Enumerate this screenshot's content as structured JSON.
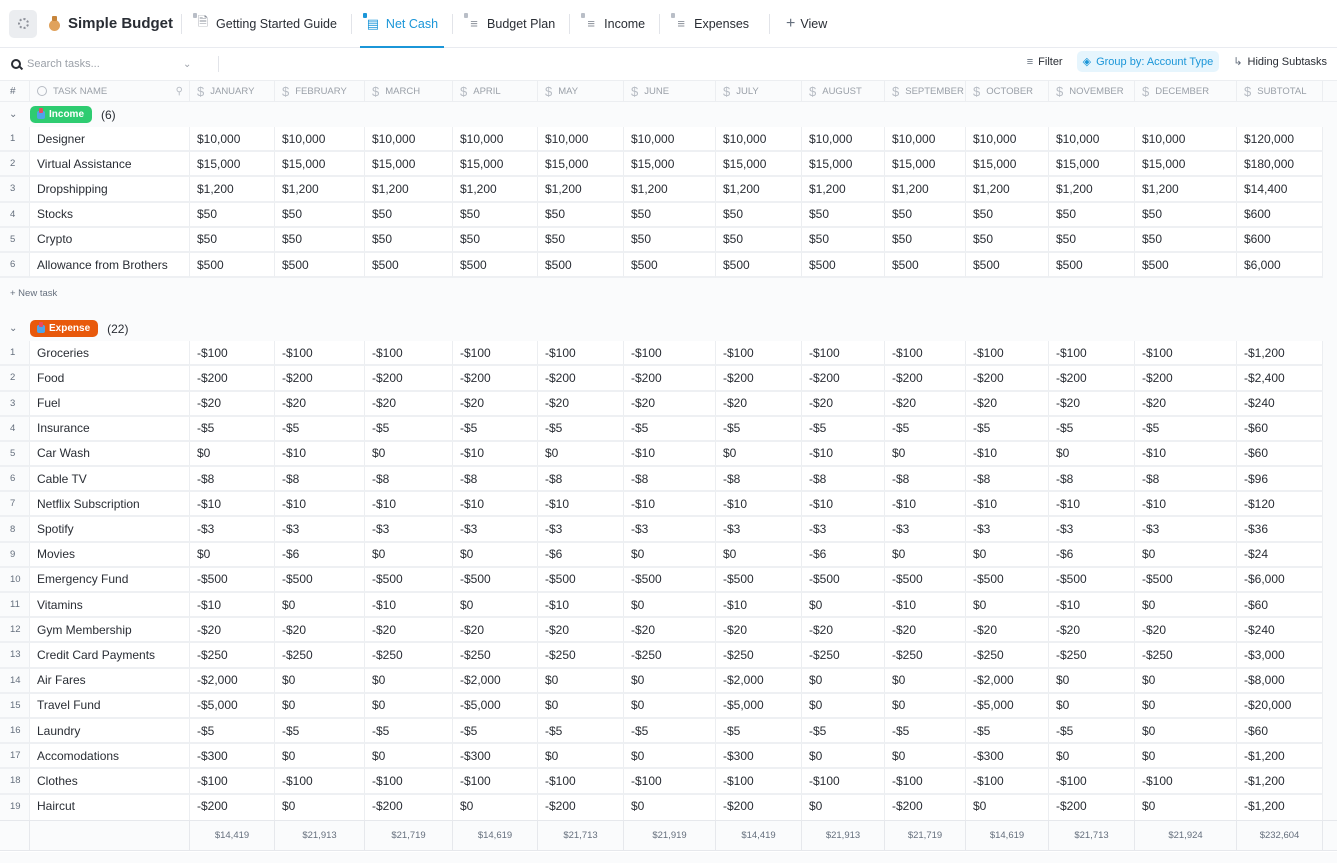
{
  "app": {
    "title": "Simple Budget",
    "workspace_icon": "loading-dots-icon",
    "title_icon": "money-bag-icon"
  },
  "tabs": [
    {
      "label": "Getting Started Guide",
      "icon": "doc-icon",
      "active": false
    },
    {
      "label": "Net Cash",
      "icon": "table-icon",
      "active": true
    },
    {
      "label": "Budget Plan",
      "icon": "list-icon",
      "active": false
    },
    {
      "label": "Income",
      "icon": "list-icon",
      "active": false
    },
    {
      "label": "Expenses",
      "icon": "list-icon",
      "active": false
    }
  ],
  "add_view_label": "View",
  "toolbar": {
    "search_placeholder": "Search tasks...",
    "filter_label": "Filter",
    "group_by_label": "Group by: Account Type",
    "subtasks_label": "Hiding Subtasks"
  },
  "colors": {
    "accent": "#1b96d8",
    "income": "#2ecc71",
    "expense": "#e8590c"
  },
  "columns": {
    "num": "#",
    "name": "TASK NAME",
    "months": [
      "JANUARY",
      "FEBRUARY",
      "MARCH",
      "APRIL",
      "MAY",
      "JUNE",
      "JULY",
      "AUGUST",
      "SEPTEMBER",
      "OCTOBER",
      "NOVEMBER",
      "DECEMBER",
      "SUBTOTAL"
    ]
  },
  "groups": [
    {
      "label": "Income",
      "count": "(6)",
      "color": "#2ecc71",
      "rows": [
        {
          "n": "1",
          "name": "Designer",
          "values": [
            "$10,000",
            "$10,000",
            "$10,000",
            "$10,000",
            "$10,000",
            "$10,000",
            "$10,000",
            "$10,000",
            "$10,000",
            "$10,000",
            "$10,000",
            "$10,000",
            "$120,000"
          ]
        },
        {
          "n": "2",
          "name": "Virtual Assistance",
          "values": [
            "$15,000",
            "$15,000",
            "$15,000",
            "$15,000",
            "$15,000",
            "$15,000",
            "$15,000",
            "$15,000",
            "$15,000",
            "$15,000",
            "$15,000",
            "$15,000",
            "$180,000"
          ]
        },
        {
          "n": "3",
          "name": "Dropshipping",
          "values": [
            "$1,200",
            "$1,200",
            "$1,200",
            "$1,200",
            "$1,200",
            "$1,200",
            "$1,200",
            "$1,200",
            "$1,200",
            "$1,200",
            "$1,200",
            "$1,200",
            "$14,400"
          ]
        },
        {
          "n": "4",
          "name": "Stocks",
          "values": [
            "$50",
            "$50",
            "$50",
            "$50",
            "$50",
            "$50",
            "$50",
            "$50",
            "$50",
            "$50",
            "$50",
            "$50",
            "$600"
          ]
        },
        {
          "n": "5",
          "name": "Crypto",
          "values": [
            "$50",
            "$50",
            "$50",
            "$50",
            "$50",
            "$50",
            "$50",
            "$50",
            "$50",
            "$50",
            "$50",
            "$50",
            "$600"
          ]
        },
        {
          "n": "6",
          "name": "Allowance from Brothers",
          "values": [
            "$500",
            "$500",
            "$500",
            "$500",
            "$500",
            "$500",
            "$500",
            "$500",
            "$500",
            "$500",
            "$500",
            "$500",
            "$6,000"
          ]
        }
      ],
      "new_task_label": "+ New task"
    },
    {
      "label": "Expense",
      "count": "(22)",
      "color": "#e8590c",
      "rows": [
        {
          "n": "1",
          "name": "Groceries",
          "values": [
            "-$100",
            "-$100",
            "-$100",
            "-$100",
            "-$100",
            "-$100",
            "-$100",
            "-$100",
            "-$100",
            "-$100",
            "-$100",
            "-$100",
            "-$1,200"
          ]
        },
        {
          "n": "2",
          "name": "Food",
          "values": [
            "-$200",
            "-$200",
            "-$200",
            "-$200",
            "-$200",
            "-$200",
            "-$200",
            "-$200",
            "-$200",
            "-$200",
            "-$200",
            "-$200",
            "-$2,400"
          ]
        },
        {
          "n": "3",
          "name": "Fuel",
          "values": [
            "-$20",
            "-$20",
            "-$20",
            "-$20",
            "-$20",
            "-$20",
            "-$20",
            "-$20",
            "-$20",
            "-$20",
            "-$20",
            "-$20",
            "-$240"
          ]
        },
        {
          "n": "4",
          "name": "Insurance",
          "values": [
            "-$5",
            "-$5",
            "-$5",
            "-$5",
            "-$5",
            "-$5",
            "-$5",
            "-$5",
            "-$5",
            "-$5",
            "-$5",
            "-$5",
            "-$60"
          ]
        },
        {
          "n": "5",
          "name": "Car Wash",
          "values": [
            "$0",
            "-$10",
            "$0",
            "-$10",
            "$0",
            "-$10",
            "$0",
            "-$10",
            "$0",
            "-$10",
            "$0",
            "-$10",
            "-$60"
          ]
        },
        {
          "n": "6",
          "name": "Cable TV",
          "values": [
            "-$8",
            "-$8",
            "-$8",
            "-$8",
            "-$8",
            "-$8",
            "-$8",
            "-$8",
            "-$8",
            "-$8",
            "-$8",
            "-$8",
            "-$96"
          ]
        },
        {
          "n": "7",
          "name": "Netflix Subscription",
          "values": [
            "-$10",
            "-$10",
            "-$10",
            "-$10",
            "-$10",
            "-$10",
            "-$10",
            "-$10",
            "-$10",
            "-$10",
            "-$10",
            "-$10",
            "-$120"
          ]
        },
        {
          "n": "8",
          "name": "Spotify",
          "values": [
            "-$3",
            "-$3",
            "-$3",
            "-$3",
            "-$3",
            "-$3",
            "-$3",
            "-$3",
            "-$3",
            "-$3",
            "-$3",
            "-$3",
            "-$36"
          ]
        },
        {
          "n": "9",
          "name": "Movies",
          "values": [
            "$0",
            "-$6",
            "$0",
            "$0",
            "-$6",
            "$0",
            "$0",
            "-$6",
            "$0",
            "$0",
            "-$6",
            "$0",
            "-$24"
          ]
        },
        {
          "n": "10",
          "name": "Emergency Fund",
          "values": [
            "-$500",
            "-$500",
            "-$500",
            "-$500",
            "-$500",
            "-$500",
            "-$500",
            "-$500",
            "-$500",
            "-$500",
            "-$500",
            "-$500",
            "-$6,000"
          ]
        },
        {
          "n": "11",
          "name": "Vitamins",
          "values": [
            "-$10",
            "$0",
            "-$10",
            "$0",
            "-$10",
            "$0",
            "-$10",
            "$0",
            "-$10",
            "$0",
            "-$10",
            "$0",
            "-$60"
          ]
        },
        {
          "n": "12",
          "name": "Gym Membership",
          "values": [
            "-$20",
            "-$20",
            "-$20",
            "-$20",
            "-$20",
            "-$20",
            "-$20",
            "-$20",
            "-$20",
            "-$20",
            "-$20",
            "-$20",
            "-$240"
          ]
        },
        {
          "n": "13",
          "name": "Credit Card Payments",
          "values": [
            "-$250",
            "-$250",
            "-$250",
            "-$250",
            "-$250",
            "-$250",
            "-$250",
            "-$250",
            "-$250",
            "-$250",
            "-$250",
            "-$250",
            "-$3,000"
          ]
        },
        {
          "n": "14",
          "name": "Air Fares",
          "values": [
            "-$2,000",
            "$0",
            "$0",
            "-$2,000",
            "$0",
            "$0",
            "-$2,000",
            "$0",
            "$0",
            "-$2,000",
            "$0",
            "$0",
            "-$8,000"
          ]
        },
        {
          "n": "15",
          "name": "Travel Fund",
          "values": [
            "-$5,000",
            "$0",
            "$0",
            "-$5,000",
            "$0",
            "$0",
            "-$5,000",
            "$0",
            "$0",
            "-$5,000",
            "$0",
            "$0",
            "-$20,000"
          ]
        },
        {
          "n": "16",
          "name": "Laundry",
          "values": [
            "-$5",
            "-$5",
            "-$5",
            "-$5",
            "-$5",
            "-$5",
            "-$5",
            "-$5",
            "-$5",
            "-$5",
            "-$5",
            "$0",
            "-$60"
          ]
        },
        {
          "n": "17",
          "name": "Accomodations",
          "values": [
            "-$300",
            "$0",
            "$0",
            "-$300",
            "$0",
            "$0",
            "-$300",
            "$0",
            "$0",
            "-$300",
            "$0",
            "$0",
            "-$1,200"
          ]
        },
        {
          "n": "18",
          "name": "Clothes",
          "values": [
            "-$100",
            "-$100",
            "-$100",
            "-$100",
            "-$100",
            "-$100",
            "-$100",
            "-$100",
            "-$100",
            "-$100",
            "-$100",
            "-$100",
            "-$1,200"
          ]
        },
        {
          "n": "19",
          "name": "Haircut",
          "values": [
            "-$200",
            "$0",
            "-$200",
            "$0",
            "-$200",
            "$0",
            "-$200",
            "$0",
            "-$200",
            "$0",
            "-$200",
            "$0",
            "-$1,200"
          ]
        }
      ]
    }
  ],
  "totals": [
    "$14,419",
    "$21,913",
    "$21,719",
    "$14,619",
    "$21,713",
    "$21,919",
    "$14,419",
    "$21,913",
    "$21,719",
    "$14,619",
    "$21,713",
    "$21,924",
    "$232,604"
  ]
}
